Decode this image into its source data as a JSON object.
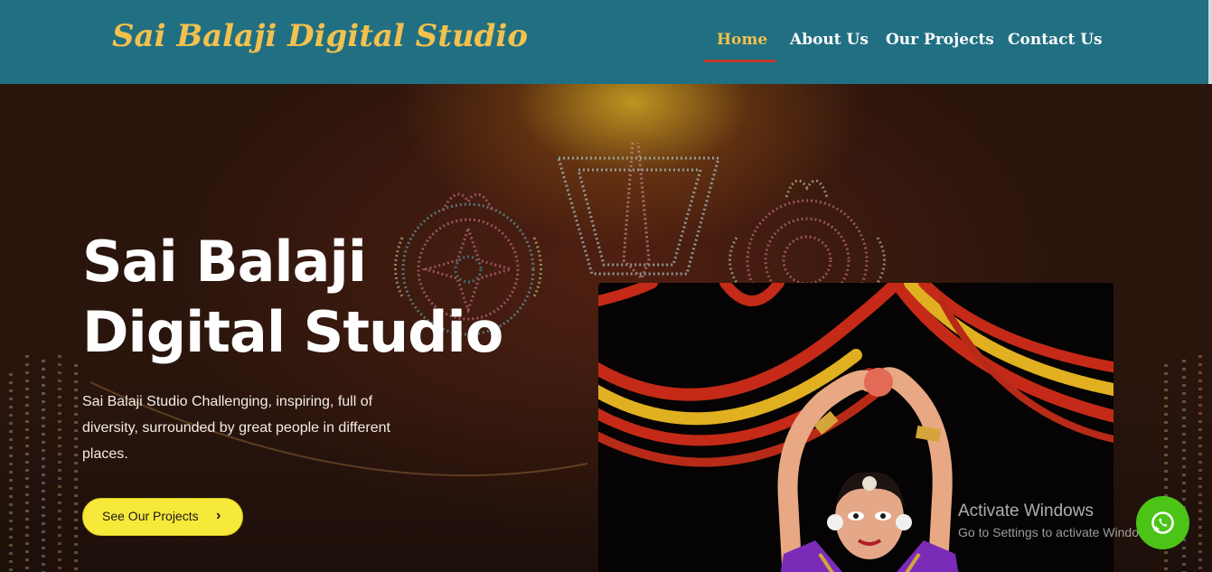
{
  "header": {
    "logo_text": "Sai Balaji Digital Studio",
    "nav": [
      {
        "label": "Home",
        "active": true
      },
      {
        "label": "About Us",
        "active": false
      },
      {
        "label": "Our Projects",
        "active": false
      },
      {
        "label": "Contact Us",
        "active": false
      }
    ]
  },
  "hero": {
    "title_line1": "Sai Balaji",
    "title_line2": "Digital Studio",
    "description": "Sai Balaji Studio Challenging, inspiring, full of diversity, surrounded by great people in different places.",
    "cta_label": "See Our Projects",
    "cta_icon": "chevron-right-icon"
  },
  "overlay": {
    "activation_title": "Activate Windows",
    "activation_subtitle": "Go to Settings to activate Windows."
  },
  "floating": {
    "whatsapp_icon": "whatsapp-icon"
  },
  "colors": {
    "header_bg": "#216f82",
    "logo": "#f2c14e",
    "active_nav": "#f2c14e",
    "nav_underline": "#c0392b",
    "cta_bg": "#f7e93a",
    "whatsapp": "#4cc417"
  }
}
